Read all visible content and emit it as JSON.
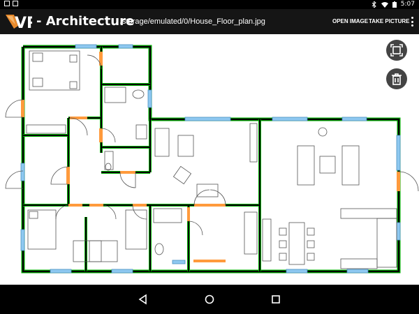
{
  "status_bar": {
    "time": "5:07"
  },
  "app_bar": {
    "logo_text": "VR",
    "title": "- Architecture",
    "file_path": "/storage/emulated/0/House_Floor_plan.jpg",
    "actions": {
      "open_image": "OPEN IMAGE",
      "take_picture": "TAKE PICTURE"
    }
  },
  "colors": {
    "app_bar_bg": "#151515",
    "wall": "#000000",
    "wall_highlight": "#00b000",
    "window": "#8ec8f0",
    "door": "#ff9a3c",
    "fab_bg": "#444444"
  },
  "icons": {
    "zoom": "fit-screen-icon",
    "trash": "trash-icon",
    "back": "back-triangle-icon",
    "home": "home-circle-icon",
    "recent": "recent-square-icon"
  }
}
